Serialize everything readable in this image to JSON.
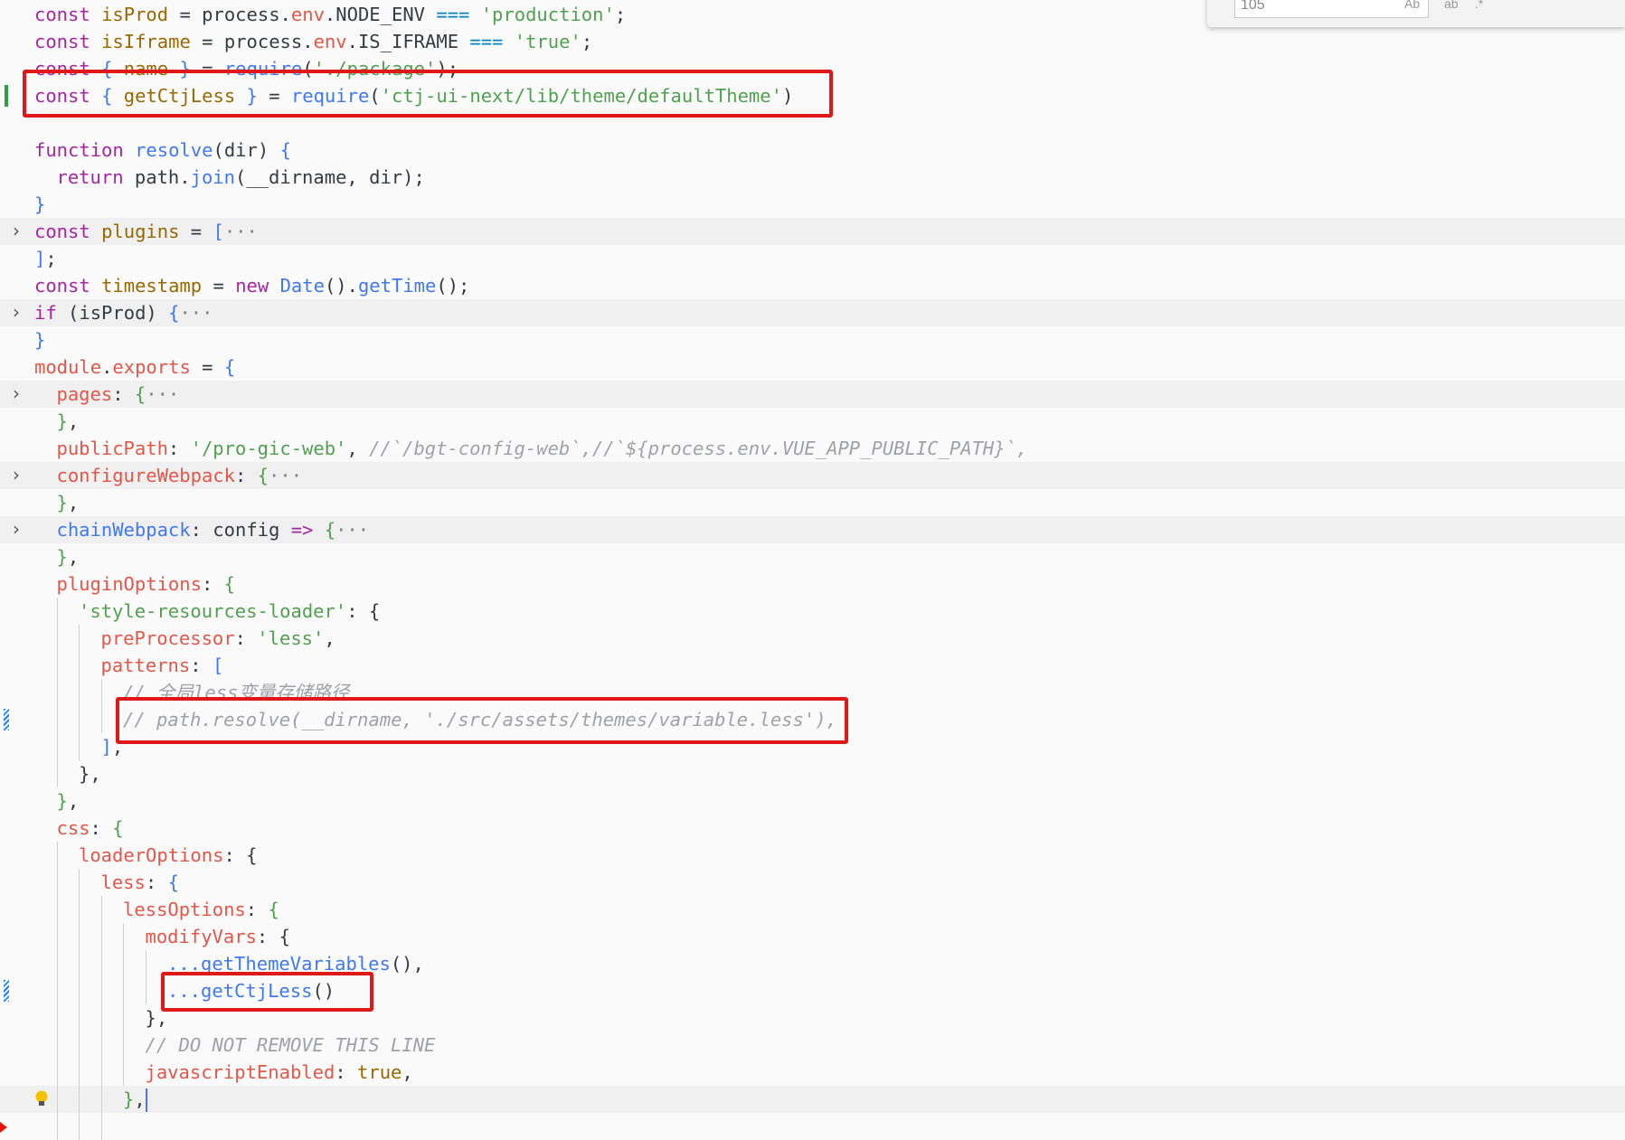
{
  "find_widget": {
    "input_value": "105",
    "match_case_label": "Ab",
    "whole_word_label": "ab",
    "regex_label": ".*"
  },
  "lines": [
    {
      "gutter": "",
      "hl": false,
      "indent": 0,
      "tokens": [
        [
          "k",
          "const "
        ],
        [
          "v",
          "isProd"
        ],
        [
          "t",
          " = process."
        ],
        [
          "p",
          "env"
        ],
        [
          "t",
          ".NODE_ENV "
        ],
        [
          "b",
          "==="
        ],
        [
          "t",
          " "
        ],
        [
          "s",
          "'production'"
        ],
        [
          "t",
          ";"
        ]
      ]
    },
    {
      "gutter": "",
      "hl": false,
      "indent": 0,
      "tokens": [
        [
          "k",
          "const "
        ],
        [
          "v",
          "isIframe"
        ],
        [
          "t",
          " = process."
        ],
        [
          "p",
          "env"
        ],
        [
          "t",
          ".IS_IFRAME "
        ],
        [
          "b",
          "==="
        ],
        [
          "t",
          " "
        ],
        [
          "s",
          "'true'"
        ],
        [
          "t",
          ";"
        ]
      ]
    },
    {
      "gutter": "",
      "hl": false,
      "indent": 0,
      "tokens": [
        [
          "k",
          "const "
        ],
        [
          "f",
          "{ "
        ],
        [
          "v",
          "name"
        ],
        [
          "f",
          " }"
        ],
        [
          "t",
          " = "
        ],
        [
          "f",
          "require"
        ],
        [
          "t",
          "("
        ],
        [
          "s",
          "'./package'"
        ],
        [
          "t",
          ");"
        ]
      ]
    },
    {
      "gutter": "add",
      "hl": false,
      "indent": 0,
      "tokens": [
        [
          "k",
          "const "
        ],
        [
          "f",
          "{ "
        ],
        [
          "v",
          "getCtjLess"
        ],
        [
          "f",
          " }"
        ],
        [
          "t",
          " = "
        ],
        [
          "f",
          "require"
        ],
        [
          "t",
          "("
        ],
        [
          "s",
          "'ctj-ui-next/lib/theme/defaultTheme'"
        ],
        [
          "t",
          ")"
        ]
      ]
    },
    {
      "gutter": "",
      "hl": false,
      "indent": 0,
      "tokens": []
    },
    {
      "gutter": "",
      "hl": false,
      "indent": 0,
      "tokens": [
        [
          "k",
          "function "
        ],
        [
          "f",
          "resolve"
        ],
        [
          "t",
          "(dir) "
        ],
        [
          "f",
          "{"
        ]
      ]
    },
    {
      "gutter": "",
      "hl": false,
      "indent": 1,
      "tokens": [
        [
          "k",
          "return "
        ],
        [
          "t",
          "path."
        ],
        [
          "f",
          "join"
        ],
        [
          "t",
          "(__dirname, dir);"
        ]
      ]
    },
    {
      "gutter": "",
      "hl": false,
      "indent": 0,
      "tokens": [
        [
          "f",
          "}"
        ]
      ]
    },
    {
      "gutter": "fold",
      "hl": true,
      "indent": 0,
      "tokens": [
        [
          "k",
          "const "
        ],
        [
          "v",
          "plugins"
        ],
        [
          "t",
          " = "
        ],
        [
          "f",
          "["
        ],
        [
          "ell",
          "···"
        ]
      ]
    },
    {
      "gutter": "",
      "hl": false,
      "indent": 0,
      "tokens": [
        [
          "f",
          "]"
        ],
        [
          "t",
          ";"
        ]
      ]
    },
    {
      "gutter": "",
      "hl": false,
      "indent": 0,
      "tokens": [
        [
          "k",
          "const "
        ],
        [
          "v",
          "timestamp"
        ],
        [
          "t",
          " = "
        ],
        [
          "k",
          "new "
        ],
        [
          "f",
          "Date"
        ],
        [
          "t",
          "()."
        ],
        [
          "f",
          "getTime"
        ],
        [
          "t",
          "();"
        ]
      ]
    },
    {
      "gutter": "fold",
      "hl": true,
      "indent": 0,
      "tokens": [
        [
          "k",
          "if "
        ],
        [
          "t",
          "(isProd) "
        ],
        [
          "f",
          "{"
        ],
        [
          "ell",
          "···"
        ]
      ]
    },
    {
      "gutter": "",
      "hl": false,
      "indent": 0,
      "tokens": [
        [
          "f",
          "}"
        ]
      ]
    },
    {
      "gutter": "",
      "hl": false,
      "indent": 0,
      "tokens": [
        [
          "p",
          "module"
        ],
        [
          "t",
          "."
        ],
        [
          "p",
          "exports"
        ],
        [
          "t",
          " = "
        ],
        [
          "f",
          "{"
        ]
      ]
    },
    {
      "gutter": "fold",
      "hl": true,
      "indent": 1,
      "tokens": [
        [
          "p",
          "pages"
        ],
        [
          "t",
          ": "
        ],
        [
          "s",
          "{"
        ],
        [
          "ell",
          "···"
        ]
      ]
    },
    {
      "gutter": "",
      "hl": false,
      "indent": 1,
      "tokens": [
        [
          "s",
          "}"
        ],
        [
          "t",
          ","
        ]
      ]
    },
    {
      "gutter": "",
      "hl": false,
      "indent": 1,
      "tokens": [
        [
          "p",
          "publicPath"
        ],
        [
          "t",
          ": "
        ],
        [
          "s",
          "'/pro-gic-web'"
        ],
        [
          "t",
          ", "
        ],
        [
          "c",
          "//`/bgt-config-web`,//`${process.env.VUE_APP_PUBLIC_PATH}`,"
        ]
      ]
    },
    {
      "gutter": "fold",
      "hl": true,
      "indent": 1,
      "tokens": [
        [
          "p",
          "configureWebpack"
        ],
        [
          "t",
          ": "
        ],
        [
          "s",
          "{"
        ],
        [
          "ell",
          "···"
        ]
      ]
    },
    {
      "gutter": "",
      "hl": false,
      "indent": 1,
      "tokens": [
        [
          "s",
          "}"
        ],
        [
          "t",
          ","
        ]
      ]
    },
    {
      "gutter": "fold",
      "hl": true,
      "indent": 1,
      "tokens": [
        [
          "f",
          "chainWebpack"
        ],
        [
          "t",
          ": config "
        ],
        [
          "k",
          "=>"
        ],
        [
          "t",
          " "
        ],
        [
          "s",
          "{"
        ],
        [
          "ell",
          "···"
        ]
      ]
    },
    {
      "gutter": "",
      "hl": false,
      "indent": 1,
      "tokens": [
        [
          "s",
          "}"
        ],
        [
          "t",
          ","
        ]
      ]
    },
    {
      "gutter": "",
      "hl": false,
      "indent": 1,
      "tokens": [
        [
          "p",
          "pluginOptions"
        ],
        [
          "t",
          ": "
        ],
        [
          "s",
          "{"
        ]
      ]
    },
    {
      "gutter": "",
      "hl": false,
      "indent": 2,
      "tokens": [
        [
          "s",
          "'style-resources-loader'"
        ],
        [
          "t",
          ": {"
        ]
      ]
    },
    {
      "gutter": "",
      "hl": false,
      "indent": 3,
      "tokens": [
        [
          "p",
          "preProcessor"
        ],
        [
          "t",
          ": "
        ],
        [
          "s",
          "'less'"
        ],
        [
          "t",
          ","
        ]
      ]
    },
    {
      "gutter": "",
      "hl": false,
      "indent": 3,
      "tokens": [
        [
          "p",
          "patterns"
        ],
        [
          "t",
          ": "
        ],
        [
          "f",
          "["
        ]
      ]
    },
    {
      "gutter": "",
      "hl": false,
      "indent": 4,
      "tokens": [
        [
          "c",
          "// 全局less变量存储路径"
        ]
      ]
    },
    {
      "gutter": "mod",
      "hl": false,
      "indent": 4,
      "tokens": [
        [
          "c",
          "// path.resolve(__dirname, './src/assets/themes/variable.less'),"
        ]
      ]
    },
    {
      "gutter": "",
      "hl": false,
      "indent": 3,
      "tokens": [
        [
          "f",
          "]"
        ],
        [
          "t",
          ","
        ]
      ]
    },
    {
      "gutter": "",
      "hl": false,
      "indent": 2,
      "tokens": [
        [
          "t",
          "},"
        ]
      ]
    },
    {
      "gutter": "",
      "hl": false,
      "indent": 1,
      "tokens": [
        [
          "s",
          "}"
        ],
        [
          "t",
          ","
        ]
      ]
    },
    {
      "gutter": "",
      "hl": false,
      "indent": 1,
      "tokens": [
        [
          "p",
          "css"
        ],
        [
          "t",
          ": "
        ],
        [
          "s",
          "{"
        ]
      ]
    },
    {
      "gutter": "",
      "hl": false,
      "indent": 2,
      "tokens": [
        [
          "p",
          "loaderOptions"
        ],
        [
          "t",
          ": {"
        ]
      ]
    },
    {
      "gutter": "",
      "hl": false,
      "indent": 3,
      "tokens": [
        [
          "p",
          "less"
        ],
        [
          "t",
          ": "
        ],
        [
          "f",
          "{"
        ]
      ]
    },
    {
      "gutter": "",
      "hl": false,
      "indent": 4,
      "tokens": [
        [
          "p",
          "lessOptions"
        ],
        [
          "t",
          ": "
        ],
        [
          "s",
          "{"
        ]
      ]
    },
    {
      "gutter": "",
      "hl": false,
      "indent": 5,
      "tokens": [
        [
          "p",
          "modifyVars"
        ],
        [
          "t",
          ": {"
        ]
      ]
    },
    {
      "gutter": "",
      "hl": false,
      "indent": 6,
      "tokens": [
        [
          "f",
          "...getThemeVariables"
        ],
        [
          "t",
          "(),"
        ]
      ]
    },
    {
      "gutter": "mod",
      "hl": false,
      "indent": 6,
      "tokens": [
        [
          "f",
          "...getCtjLess"
        ],
        [
          "t",
          "()"
        ]
      ]
    },
    {
      "gutter": "",
      "hl": false,
      "indent": 5,
      "tokens": [
        [
          "t",
          "},"
        ]
      ]
    },
    {
      "gutter": "",
      "hl": false,
      "indent": 5,
      "tokens": [
        [
          "c",
          "// DO NOT REMOVE THIS LINE"
        ]
      ]
    },
    {
      "gutter": "",
      "hl": false,
      "indent": 5,
      "tokens": [
        [
          "p",
          "javascriptEnabled"
        ],
        [
          "t",
          ": "
        ],
        [
          "v",
          "true"
        ],
        [
          "t",
          ","
        ]
      ]
    },
    {
      "gutter": "bulb",
      "hl": true,
      "indent": 4,
      "tokens": [
        [
          "s",
          "}"
        ],
        [
          "t",
          ","
        ],
        [
          "cursor",
          ""
        ]
      ]
    },
    {
      "gutter": "err",
      "hl": false,
      "indent": 4,
      "tokens": []
    }
  ]
}
